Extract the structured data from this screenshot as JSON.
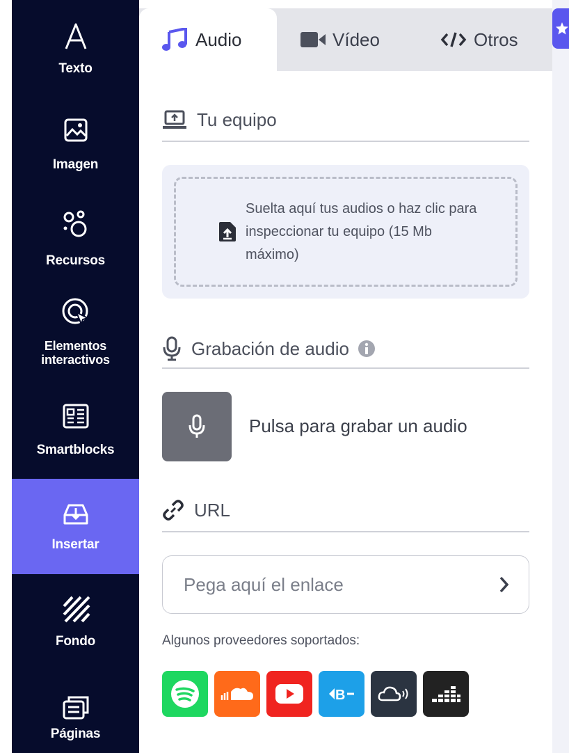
{
  "sidebar": {
    "items": [
      {
        "label": "Texto",
        "icon": "text-icon"
      },
      {
        "label": "Imagen",
        "icon": "image-icon"
      },
      {
        "label": "Recursos",
        "icon": "resources-icon"
      },
      {
        "label": "Elementos interactivos",
        "icon": "interactive-icon"
      },
      {
        "label": "Smartblocks",
        "icon": "smartblocks-icon"
      },
      {
        "label": "Insertar",
        "icon": "insert-icon",
        "active": true
      },
      {
        "label": "Fondo",
        "icon": "background-icon"
      },
      {
        "label": "Páginas",
        "icon": "pages-icon"
      }
    ]
  },
  "tabs": {
    "audio": "Audio",
    "video": "Vídeo",
    "otros": "Otros"
  },
  "computer": {
    "title": "Tu equipo",
    "drop_text": "Suelta aquí tus audios o haz clic para inspeccionar tu equipo (15 Mb máximo)"
  },
  "recording": {
    "title": "Grabación de audio",
    "button_label": "Pulsa para grabar un audio"
  },
  "url": {
    "title": "URL",
    "placeholder": "Pega aquí el enlace"
  },
  "providers": {
    "label": "Algunos proveedores soportados:",
    "items": [
      {
        "name": "spotify-icon",
        "color": "#1ed760"
      },
      {
        "name": "soundcloud-icon",
        "color": "#ff6a1a"
      },
      {
        "name": "youtube-icon",
        "color": "#f02420"
      },
      {
        "name": "bandcamp-icon",
        "color": "#1da0e8"
      },
      {
        "name": "cloud-audio-icon",
        "color": "#2b3441"
      },
      {
        "name": "deezer-icon",
        "color": "#222222"
      }
    ]
  },
  "colors": {
    "sidebar_bg": "#060c2c",
    "accent": "#6a67f2",
    "tab_bg": "#e4e5ea"
  }
}
